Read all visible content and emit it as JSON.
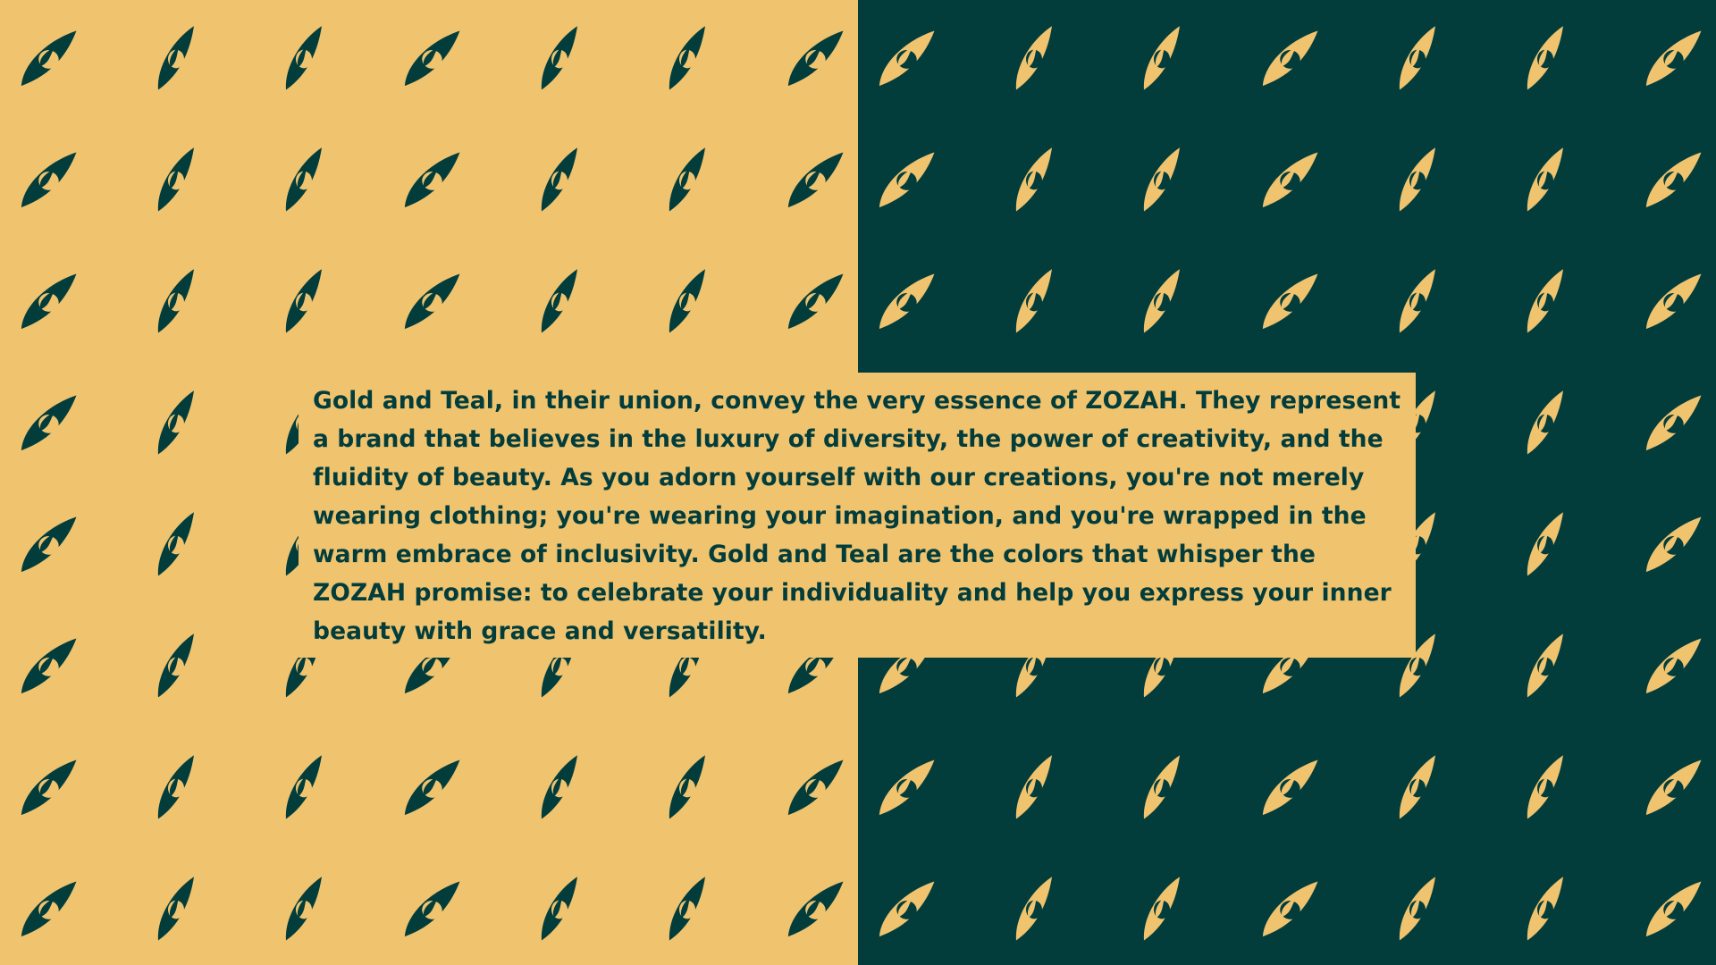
{
  "brand_text": {
    "paragraph": "Gold and Teal, in their union, convey the very essence of ZOZAH. They represent a brand that believes in the luxury of diversity, the power of creativity, and the fluidity of beauty. As you adorn yourself with our creations, you're not merely wearing clothing; you're wearing your imagination, and you're wrapped in the warm embrace of inclusivity. Gold and Teal are the colors that whisper the ZOZAH promise: to celebrate your individuality and help you express your inner beauty with grace and versatility."
  },
  "colors": {
    "gold": "#f0c36f",
    "teal": "#023d3c"
  },
  "patterns": {
    "gold_panel_icon": "leaf-flame-logo-icon",
    "teal_panel_icon": "leaf-flame-logo-icon"
  }
}
